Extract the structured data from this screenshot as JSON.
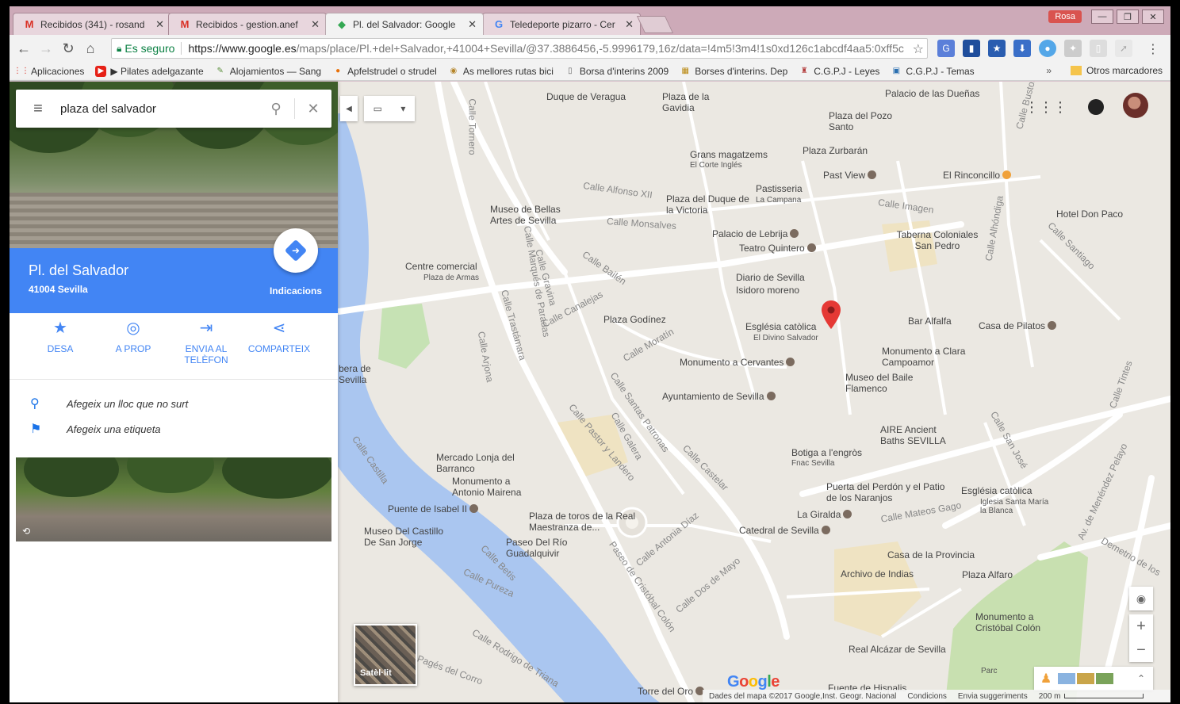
{
  "browser": {
    "tabs": [
      {
        "title": "Recibidos (341) - rosand",
        "icon": "gmail-icon",
        "color": "#d93025"
      },
      {
        "title": "Recibidos - gestion.anef",
        "icon": "gmail-icon",
        "color": "#d93025"
      },
      {
        "title": "Pl. del Salvador: Google",
        "icon": "maps-icon",
        "color": "#34a853"
      },
      {
        "title": "Teledeporte pizarro - Cer",
        "icon": "google-icon",
        "color": "#4285f4"
      }
    ],
    "active_tab": 2,
    "user_chip": "Rosa",
    "secure_label": "Es seguro",
    "url_host": "https://www.google.es",
    "url_path": "/maps/place/Pl.+del+Salvador,+41004+Sevilla/@37.3886456,-5.9996179,16z/data=!4m5!3m4!1s0xd126c1abcdf4aa5:0xff5c",
    "bookmarks": [
      {
        "label": "Aplicaciones",
        "icon": "apps-grid-icon"
      },
      {
        "label": "▶ Pilates adelgazante",
        "icon": "youtube-icon"
      },
      {
        "label": "Alojamientos — Sang",
        "icon": "bookmark-icon"
      },
      {
        "label": "Apfelstrudel o strudel",
        "icon": "bookmark-icon"
      },
      {
        "label": "As mellores rutas bici",
        "icon": "bookmark-icon"
      },
      {
        "label": "Borsa d'interins 2009",
        "icon": "page-icon"
      },
      {
        "label": "Borses d'interins. Dep",
        "icon": "bookmark-icon"
      },
      {
        "label": "C.G.P.J - Leyes",
        "icon": "bookmark-icon"
      },
      {
        "label": "C.G.P.J - Temas",
        "icon": "bookmark-icon"
      }
    ],
    "bookmarks_more": "»",
    "other_bookmarks": "Otros marcadores"
  },
  "panel": {
    "search_value": "plaza del salvador",
    "place_title": "Pl. del Salvador",
    "place_subtitle": "41004 Sevilla",
    "directions_label": "Indicacions",
    "actions": [
      {
        "label": "DESA",
        "icon": "star-icon"
      },
      {
        "label": "A PROP",
        "icon": "nearby-icon"
      },
      {
        "label": "ENVIA AL TELÈFON",
        "icon": "send-to-phone-icon"
      },
      {
        "label": "COMPARTEIX",
        "icon": "share-icon"
      }
    ],
    "links": [
      {
        "label": "Afegeix un lloc que no surt",
        "icon": "add-place-icon"
      },
      {
        "label": "Afegeix una etiqueta",
        "icon": "flag-icon"
      }
    ]
  },
  "map": {
    "labels": [
      {
        "text": "Duque de Veragua",
        "kind": "place"
      },
      {
        "text": "Plaza de la Gavidia",
        "kind": "place"
      },
      {
        "text": "Palacio de las Dueñas",
        "kind": "place"
      },
      {
        "text": "Plaza del Pozo Santo",
        "kind": "place"
      },
      {
        "text": "Plaza Zurbarán",
        "kind": "place"
      },
      {
        "text": "Grans magatzems",
        "kind": "place"
      },
      {
        "text": "El Corte Inglés",
        "kind": "small"
      },
      {
        "text": "Past View",
        "kind": "place"
      },
      {
        "text": "El Rinconcillo",
        "kind": "place"
      },
      {
        "text": "Pastisseria",
        "kind": "place"
      },
      {
        "text": "La Campana",
        "kind": "small"
      },
      {
        "text": "Calle Alfonso XII",
        "kind": "street"
      },
      {
        "text": "Plaza del Duque de la Victoria",
        "kind": "place"
      },
      {
        "text": "Calle Imagen",
        "kind": "street"
      },
      {
        "text": "Hotel Don Paco",
        "kind": "place"
      },
      {
        "text": "Museo de Bellas Artes de Sevilla",
        "kind": "place"
      },
      {
        "text": "Calle Monsalves",
        "kind": "street"
      },
      {
        "text": "Palacio de Lebrija",
        "kind": "place"
      },
      {
        "text": "Teatro Quintero",
        "kind": "place"
      },
      {
        "text": "Taberna Coloniales San Pedro",
        "kind": "place"
      },
      {
        "text": "Centre comercial",
        "kind": "place"
      },
      {
        "text": "Plaza de Armas",
        "kind": "small"
      },
      {
        "text": "Diario de Sevilla",
        "kind": "place"
      },
      {
        "text": "Isidoro moreno",
        "kind": "place"
      },
      {
        "text": "Calle Canalejas",
        "kind": "street"
      },
      {
        "text": "Plaza Godínez",
        "kind": "place"
      },
      {
        "text": "Església catòlica",
        "kind": "place"
      },
      {
        "text": "El Divino Salvador",
        "kind": "small"
      },
      {
        "text": "Bar Alfalfa",
        "kind": "place"
      },
      {
        "text": "Casa de Pilatos",
        "kind": "place"
      },
      {
        "text": "Monumento a Clara Campoamor",
        "kind": "place"
      },
      {
        "text": "Monumento a Cervantes",
        "kind": "place"
      },
      {
        "text": "Museo del Baile Flamenco",
        "kind": "place"
      },
      {
        "text": "Ayuntamiento de Sevilla",
        "kind": "place"
      },
      {
        "text": "AIRE Ancient Baths SEVILLA",
        "kind": "place"
      },
      {
        "text": "Botiga a l'engròs",
        "kind": "place"
      },
      {
        "text": "Fnac Sevilla",
        "kind": "small"
      },
      {
        "text": "Mercado Lonja del Barranco",
        "kind": "place"
      },
      {
        "text": "Monumento a Antonio Mairena",
        "kind": "place"
      },
      {
        "text": "Puente de Isabel II",
        "kind": "place"
      },
      {
        "text": "Puerta del Perdón y el Patio de los Naranjos",
        "kind": "place"
      },
      {
        "text": "Església catòlica",
        "kind": "place"
      },
      {
        "text": "Iglesia Santa María la Blanca",
        "kind": "small"
      },
      {
        "text": "La Giralda",
        "kind": "place"
      },
      {
        "text": "Calle Mateos Gago",
        "kind": "street"
      },
      {
        "text": "Plaza de toros de la Real Maestranza de...",
        "kind": "place"
      },
      {
        "text": "Museo Del Castillo De San Jorge",
        "kind": "place"
      },
      {
        "text": "Paseo Del Río Guadalquivir",
        "kind": "place"
      },
      {
        "text": "Catedral de Sevilla",
        "kind": "place"
      },
      {
        "text": "Casa de la Provincia",
        "kind": "place"
      },
      {
        "text": "Archivo de Indias",
        "kind": "place"
      },
      {
        "text": "Plaza Alfaro",
        "kind": "place"
      },
      {
        "text": "Monumento a Cristóbal Colón",
        "kind": "place"
      },
      {
        "text": "Real Alcázar de Sevilla",
        "kind": "place"
      },
      {
        "text": "Parc",
        "kind": "small"
      },
      {
        "text": "Torre del Oro",
        "kind": "place"
      },
      {
        "text": "Fuente de Hispalis",
        "kind": "place"
      },
      {
        "text": "bera de Sevilla",
        "kind": "place"
      },
      {
        "text": "Calle Castilla",
        "kind": "street"
      },
      {
        "text": "Calle Betis",
        "kind": "street"
      },
      {
        "text": "Calle Pureza",
        "kind": "street"
      },
      {
        "text": "Calle Rodrigo de Triana",
        "kind": "street"
      },
      {
        "text": "Pagés del Corro",
        "kind": "street"
      },
      {
        "text": "Calle Tornero",
        "kind": "street"
      },
      {
        "text": "Calle Gravina",
        "kind": "street"
      },
      {
        "text": "Calle Marqués de Paradas",
        "kind": "street"
      },
      {
        "text": "Calle Arjona",
        "kind": "street"
      },
      {
        "text": "Calle Trastámara",
        "kind": "street"
      },
      {
        "text": "Calle Bailén",
        "kind": "street"
      },
      {
        "text": "Calle Moratín",
        "kind": "street"
      },
      {
        "text": "Calle Pastor y Landero",
        "kind": "street"
      },
      {
        "text": "Calle Santas Patronas",
        "kind": "street"
      },
      {
        "text": "Calle Galera",
        "kind": "street"
      },
      {
        "text": "Calle Castelar",
        "kind": "street"
      },
      {
        "text": "Calle Antonia Díaz",
        "kind": "street"
      },
      {
        "text": "Paseo de Cristóbal Colón",
        "kind": "street"
      },
      {
        "text": "Calle Dos de Mayo",
        "kind": "street"
      },
      {
        "text": "Calle San José",
        "kind": "street"
      },
      {
        "text": "Calle Santiago",
        "kind": "street"
      },
      {
        "text": "Calle Tintes",
        "kind": "street"
      },
      {
        "text": "Av. de Menéndez Pelayo",
        "kind": "street"
      },
      {
        "text": "Demetrio de los",
        "kind": "street"
      },
      {
        "text": "Calle Alhóndiga",
        "kind": "street"
      },
      {
        "text": "Calle Bustos",
        "kind": "street"
      }
    ],
    "satellite_label": "Satèl·lit",
    "google_logo": "Google",
    "footer": {
      "attribution": "Dades del mapa ©2017 Google,Inst. Geogr. Nacional",
      "terms": "Condicions",
      "feedback": "Envia suggeriments",
      "scale": "200 m"
    }
  }
}
